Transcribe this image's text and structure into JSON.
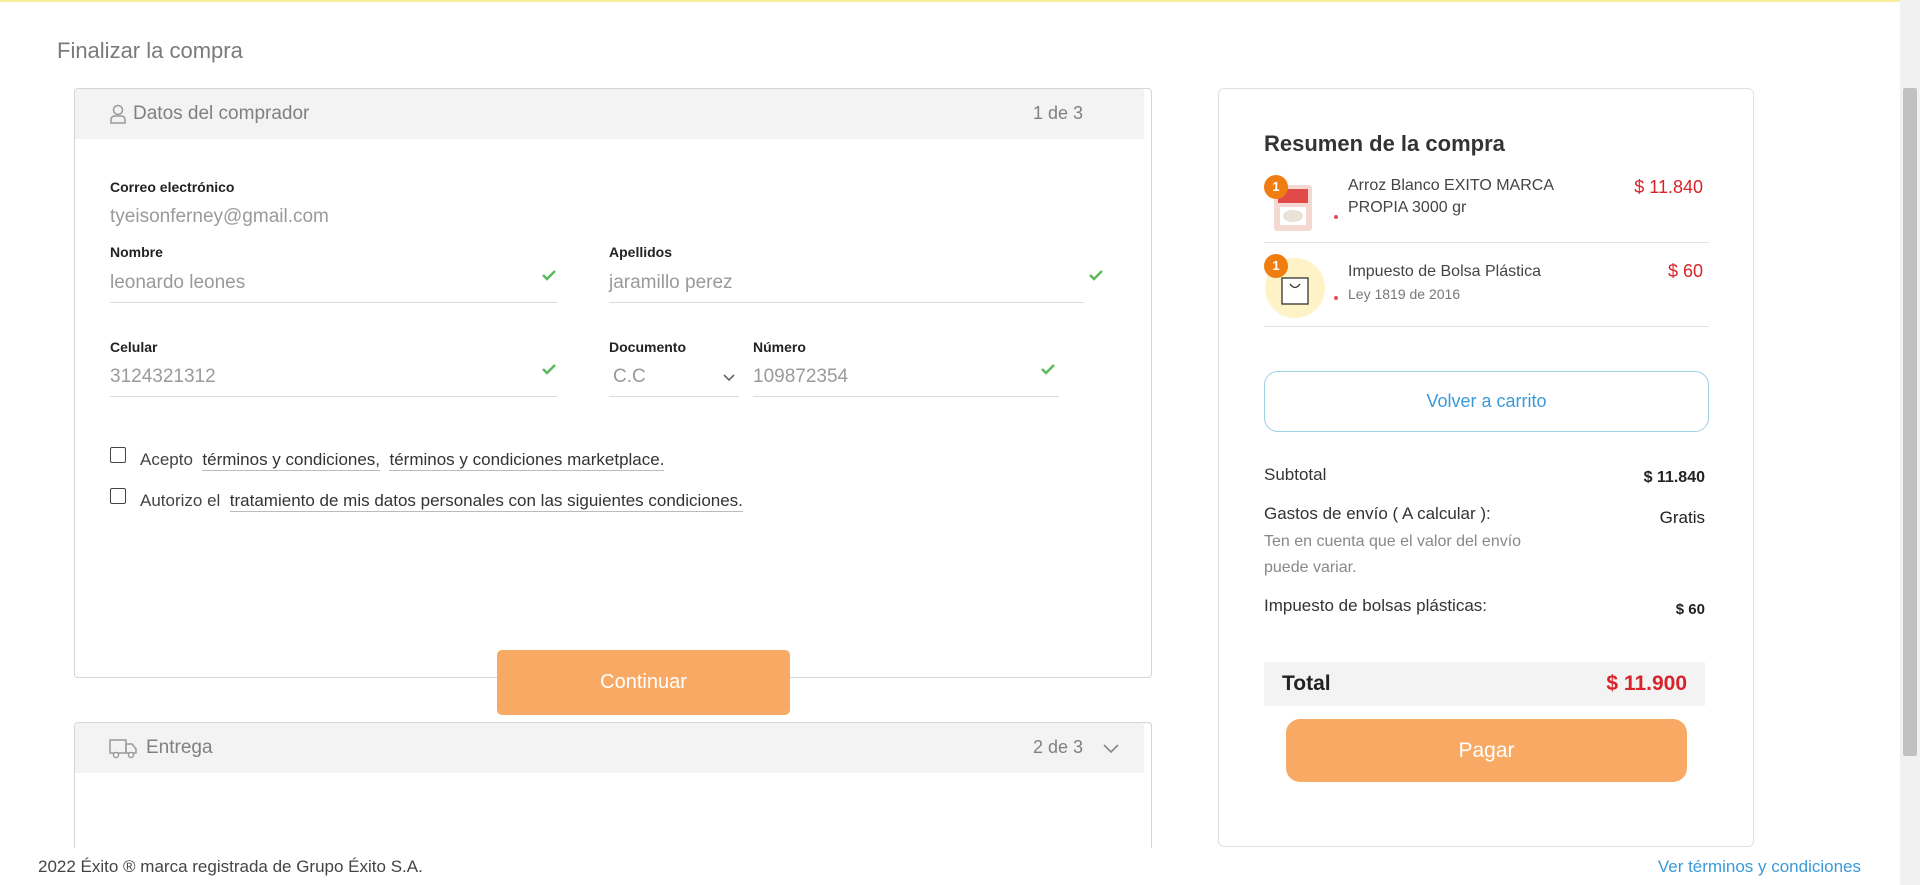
{
  "page": {
    "title": "Finalizar la compra"
  },
  "buyer": {
    "header_title": "Datos del comprador",
    "step": "1 de 3",
    "email": {
      "label": "Correo electrónico",
      "value": "tyeisonferney@gmail.com"
    },
    "first_name": {
      "label": "Nombre",
      "value": "leonardo leones"
    },
    "last_name": {
      "label": "Apellidos",
      "value": "jaramillo perez"
    },
    "phone": {
      "label": "Celular",
      "value": "3124321312"
    },
    "document": {
      "label": "Documento",
      "value": "C.C"
    },
    "number": {
      "label": "Número",
      "value": "109872354"
    },
    "terms": {
      "prefix": "Acepto",
      "link1": "términos y condiciones,",
      "link2": "términos y condiciones marketplace."
    },
    "privacy": {
      "prefix": "Autorizo el",
      "link": "tratamiento de mis datos personales con las siguientes condiciones."
    },
    "continue_label": "Continuar"
  },
  "delivery": {
    "header_title": "Entrega",
    "step": "2 de 3"
  },
  "summary": {
    "title": "Resumen de la compra",
    "items": [
      {
        "qty": "1",
        "name": "Arroz Blanco EXITO MARCA PROPIA 3000 gr",
        "sub": "",
        "price": "$ 11.840"
      },
      {
        "qty": "1",
        "name": "Impuesto de Bolsa Plástica",
        "sub": "Ley 1819 de 2016",
        "price": "$ 60"
      }
    ],
    "back_label": "Volver a carrito",
    "subtotal_label": "Subtotal",
    "subtotal_value": "$ 11.840",
    "shipping_label": "Gastos de envío ( A calcular ):",
    "shipping_value": "Gratis",
    "shipping_note": "Ten en cuenta que el valor del envío puede variar.",
    "bag_tax_label": "Impuesto de bolsas plásticas:",
    "bag_tax_value": "$ 60",
    "total_label": "Total",
    "total_value": "$ 11.900",
    "pay_label": "Pagar"
  },
  "footer": {
    "copyright": "2022 Éxito ® marca registrada de Grupo Éxito S.A.",
    "terms_link": "Ver términos y condiciones"
  },
  "colors": {
    "accent_orange": "#f8aa65",
    "price_red": "#d8232a",
    "link_blue": "#3a9ad9",
    "check_green": "#5cb85c",
    "badge_orange": "#ef7d12"
  }
}
